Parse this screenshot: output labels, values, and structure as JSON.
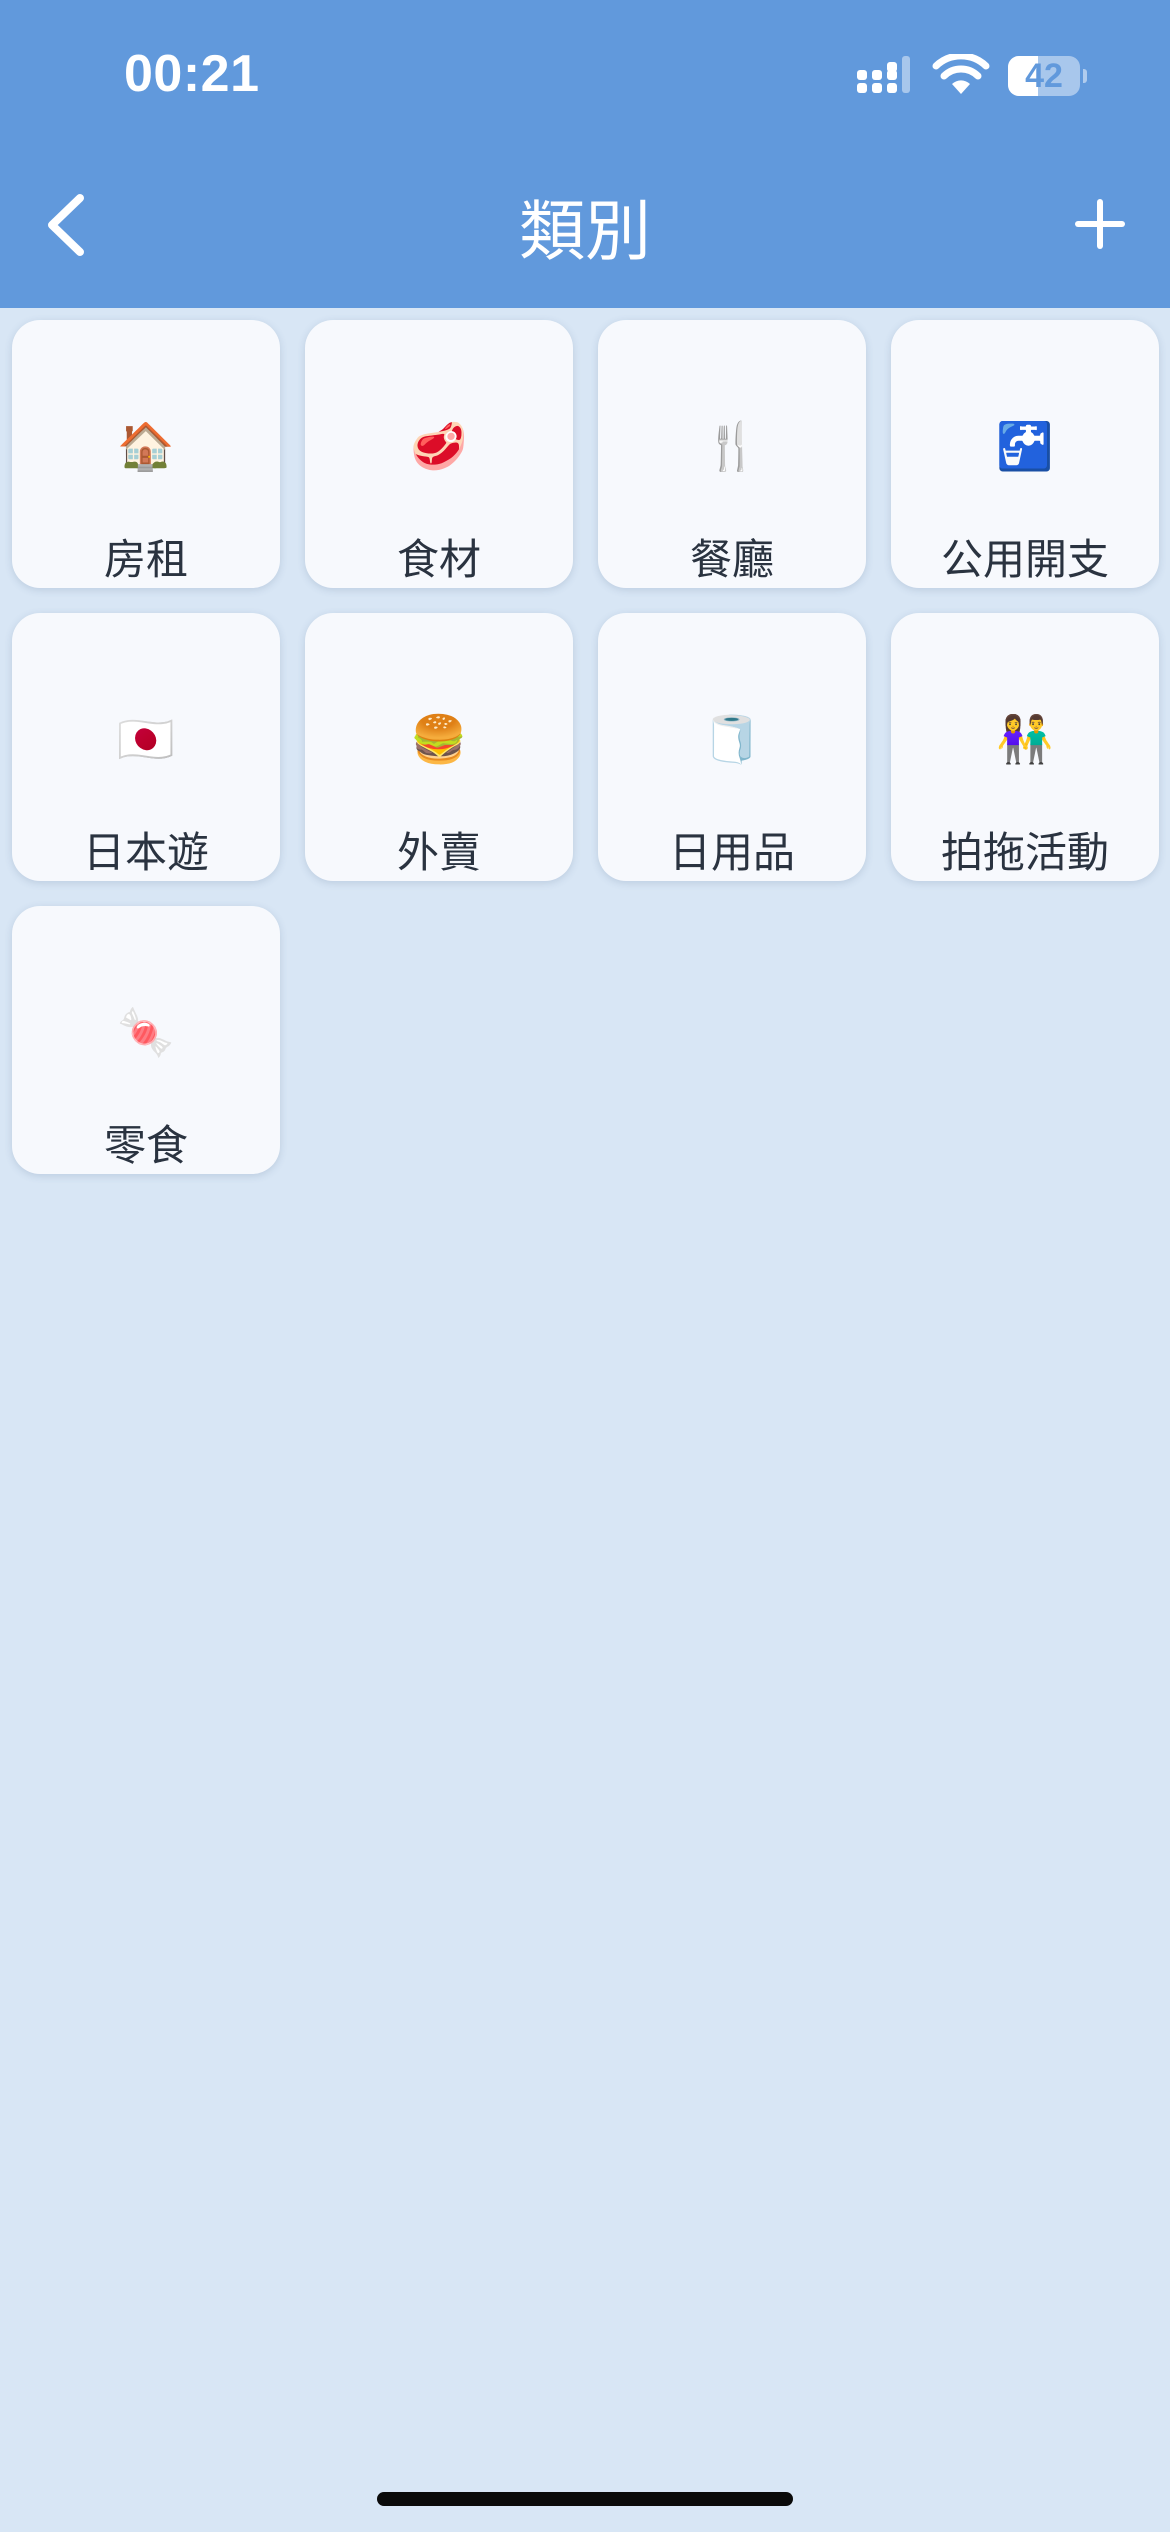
{
  "status_bar": {
    "time": "00:21",
    "battery_level": "42",
    "battery_fraction": 0.42
  },
  "nav": {
    "title": "類別"
  },
  "categories": [
    {
      "icon": "🏠",
      "icon_name": "house-icon",
      "label": "房租"
    },
    {
      "icon": "🥩",
      "icon_name": "meat-icon",
      "label": "食材"
    },
    {
      "icon": "🍴",
      "icon_name": "fork-knife-icon",
      "label": "餐廳"
    },
    {
      "icon": "🚰",
      "icon_name": "water-tap-icon",
      "label": "公用開支"
    },
    {
      "icon": "🇯🇵",
      "icon_name": "japan-flag-icon",
      "label": "日本遊"
    },
    {
      "icon": "🍔",
      "icon_name": "burger-icon",
      "label": "外賣"
    },
    {
      "icon": "🧻",
      "icon_name": "toilet-paper-icon",
      "label": "日用品"
    },
    {
      "icon": "👫",
      "icon_name": "couple-icon",
      "label": "拍拖活動"
    },
    {
      "icon": "🍬",
      "icon_name": "candy-icon",
      "label": "零食"
    }
  ],
  "colors": {
    "header": "#6199dc",
    "background": "#d8e6f5",
    "tile": "#f7f9fd",
    "label": "#2a3340"
  }
}
